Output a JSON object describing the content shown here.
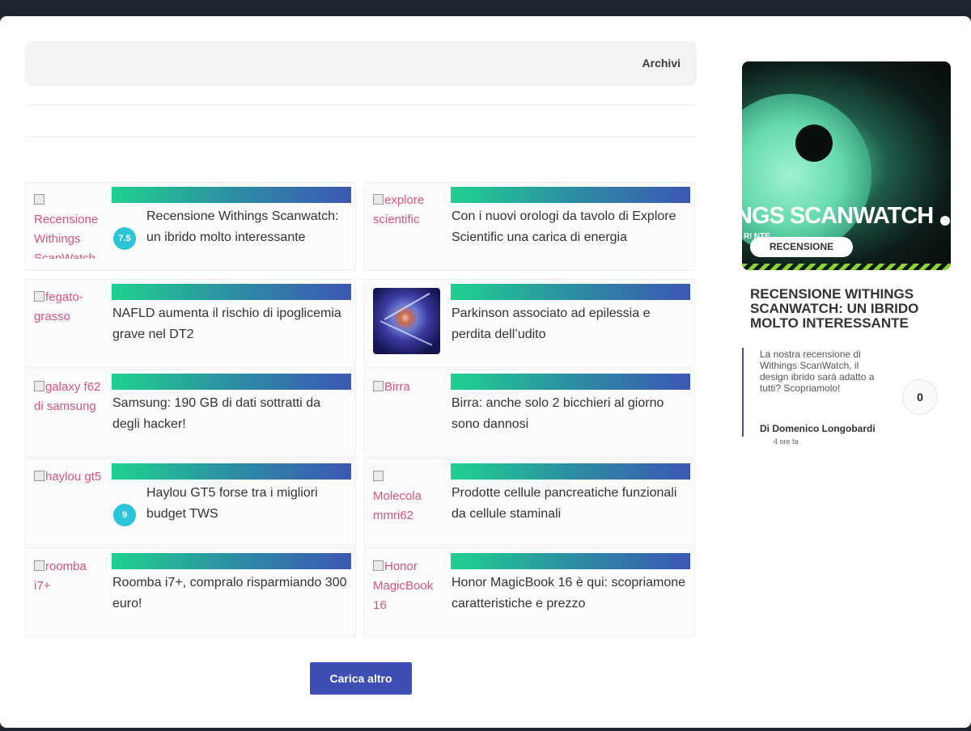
{
  "archive": {
    "label": "Archivi"
  },
  "articles": [
    {
      "thumb_alt": "Recensione Withings ScanWatch",
      "title": "Recensione Withings Scanwatch: un ibrido molto interessante",
      "score": "7.5"
    },
    {
      "thumb_alt": "explore scientific",
      "title": "Con i nuovi orologi da tavolo di Explore Scientific una carica di energia"
    },
    {
      "thumb_alt": "fegato-grasso",
      "title": "NAFLD aumenta il rischio di ipoglicemia grave nel DT2"
    },
    {
      "thumb_alt": "",
      "title": "Parkinson associato ad epilessia e perdita dell’udito"
    },
    {
      "thumb_alt": "galaxy f62 di samsung",
      "title": "Samsung: 190 GB di dati sottratti da degli hacker!"
    },
    {
      "thumb_alt": "Birra",
      "title": "Birra: anche solo 2 bicchieri al giorno sono dannosi"
    },
    {
      "thumb_alt": "haylou gt5",
      "title": "Haylou GT5 forse tra i migliori budget TWS",
      "score": "9"
    },
    {
      "thumb_alt": "Molecola mmri62",
      "title": "Prodotte cellule pancreatiche funzionali da cellule staminali"
    },
    {
      "thumb_alt": "roomba i7+",
      "title": "Roomba i7+, compralo risparmiando 300 euro!"
    },
    {
      "thumb_alt": "Honor MagicBook 16",
      "title": "Honor MagicBook 16 è qui: scopriamone caratteristiche e prezzo"
    }
  ],
  "load_more": "Carica altro",
  "featured": {
    "image_headline": "NGS SCANWATCH",
    "image_sub": "RI      NTE",
    "tag": "RECENSIONE",
    "title": "Recensione Withings Scanwatch: un ibrido molto interessante",
    "excerpt": "La nostra recensione di Withings ScanWatch, il design ibrido sarà adatto a tutti? Scopriamolo!",
    "comments": "0",
    "author": "Di Domenico Longobardi",
    "time": "4 ore fa"
  },
  "colors": {
    "accent": "#3d4fb5",
    "score_bg": "#2bc4d9",
    "gradient_start": "#1fd18f",
    "gradient_end": "#3c57b4",
    "alt_text": "#d6557c"
  }
}
